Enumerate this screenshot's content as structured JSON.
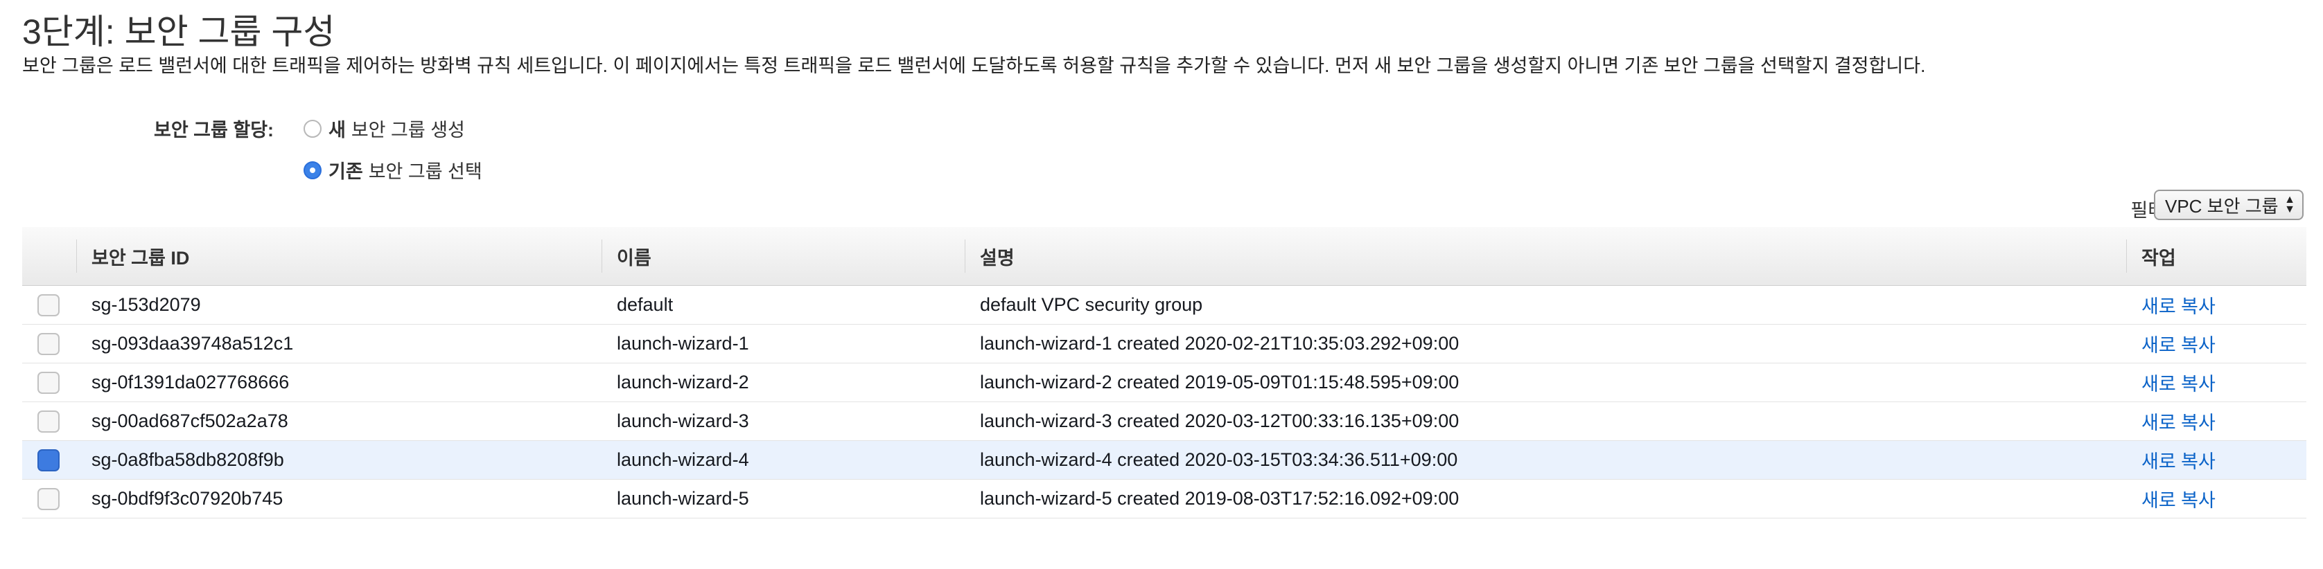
{
  "page": {
    "title": "3단계: 보안 그룹 구성",
    "description": "보안 그룹은 로드 밸런서에 대한 트래픽을 제어하는 방화벽 규칙 세트입니다. 이 페이지에서는 특정 트래픽을 로드 밸런서에 도달하도록 허용할 규칙을 추가할 수 있습니다. 먼저 새 보안 그룹을 생성할지 아니면 기존 보안 그룹을 선택할지 결정합니다."
  },
  "assign": {
    "label": "보안 그룹 할당:",
    "options": [
      {
        "bold": "새",
        "rest": "보안 그룹 생성",
        "selected": false
      },
      {
        "bold": "기존",
        "rest": "보안 그룹 선택",
        "selected": true
      }
    ]
  },
  "filter": {
    "label": "필터",
    "selected": "VPC 보안 그룹"
  },
  "table": {
    "headers": [
      "보안 그룹 ID",
      "이름",
      "설명",
      "작업"
    ],
    "rows": [
      {
        "checked": false,
        "id": "sg-153d2079",
        "name": "default",
        "desc": "default VPC security group",
        "action": "새로 복사"
      },
      {
        "checked": false,
        "id": "sg-093daa39748a512c1",
        "name": "launch-wizard-1",
        "desc": "launch-wizard-1 created 2020-02-21T10:35:03.292+09:00",
        "action": "새로 복사"
      },
      {
        "checked": false,
        "id": "sg-0f1391da027768666",
        "name": "launch-wizard-2",
        "desc": "launch-wizard-2 created 2019-05-09T01:15:48.595+09:00",
        "action": "새로 복사"
      },
      {
        "checked": false,
        "id": "sg-00ad687cf502a2a78",
        "name": "launch-wizard-3",
        "desc": "launch-wizard-3 created 2020-03-12T00:33:16.135+09:00",
        "action": "새로 복사"
      },
      {
        "checked": true,
        "id": "sg-0a8fba58db8208f9b",
        "name": "launch-wizard-4",
        "desc": "launch-wizard-4 created 2020-03-15T03:34:36.511+09:00",
        "action": "새로 복사"
      },
      {
        "checked": false,
        "id": "sg-0bdf9f3c07920b745",
        "name": "launch-wizard-5",
        "desc": "launch-wizard-5 created 2019-08-03T17:52:16.092+09:00",
        "action": "새로 복사"
      }
    ]
  }
}
